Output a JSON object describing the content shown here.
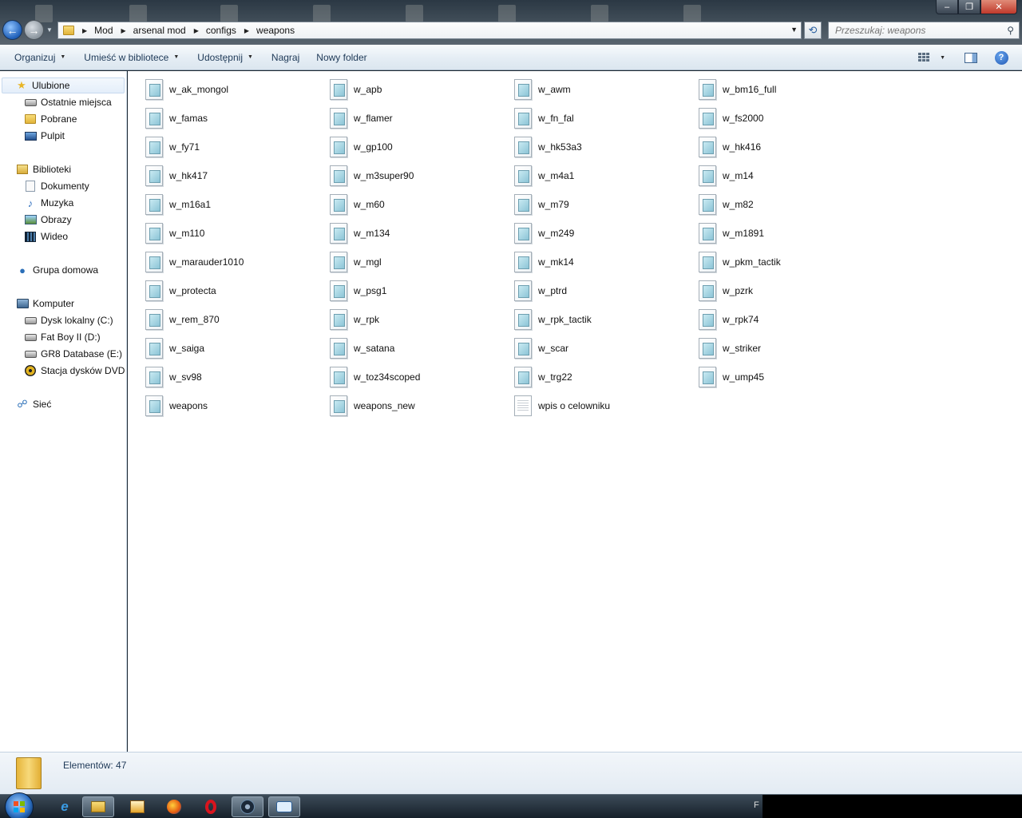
{
  "window": {
    "minimize_label": "–",
    "maximize_label": "❐",
    "close_label": "✕"
  },
  "address": {
    "crumbs": [
      "Mod",
      "arsenal mod",
      "configs",
      "weapons"
    ]
  },
  "search": {
    "placeholder": "Przeszukaj: weapons"
  },
  "toolbar": {
    "organize": "Organizuj",
    "include_library": "Umieść w bibliotece",
    "share": "Udostępnij",
    "burn": "Nagraj",
    "new_folder": "Nowy folder"
  },
  "nav": {
    "favorites": "Ulubione",
    "recent": "Ostatnie miejsca",
    "downloads": "Pobrane",
    "desktop": "Pulpit",
    "libraries": "Biblioteki",
    "documents": "Dokumenty",
    "music": "Muzyka",
    "pictures": "Obrazy",
    "videos": "Wideo",
    "homegroup": "Grupa domowa",
    "computer": "Komputer",
    "drive_c": "Dysk lokalny (C:)",
    "drive_d": "Fat Boy II (D:)",
    "drive_e": "GR8 Database (E:)",
    "drive_dvd": "Stacja dysków DVD F",
    "network": "Sieć"
  },
  "files": [
    {
      "name": "w_ak_mongol",
      "type": "cfg"
    },
    {
      "name": "w_apb",
      "type": "cfg"
    },
    {
      "name": "w_awm",
      "type": "cfg"
    },
    {
      "name": "w_bm16_full",
      "type": "cfg"
    },
    {
      "name": "w_famas",
      "type": "cfg"
    },
    {
      "name": "w_flamer",
      "type": "cfg"
    },
    {
      "name": "w_fn_fal",
      "type": "cfg"
    },
    {
      "name": "w_fs2000",
      "type": "cfg"
    },
    {
      "name": "w_fy71",
      "type": "cfg"
    },
    {
      "name": "w_gp100",
      "type": "cfg"
    },
    {
      "name": "w_hk53a3",
      "type": "cfg"
    },
    {
      "name": "w_hk416",
      "type": "cfg"
    },
    {
      "name": "w_hk417",
      "type": "cfg"
    },
    {
      "name": "w_m3super90",
      "type": "cfg"
    },
    {
      "name": "w_m4a1",
      "type": "cfg"
    },
    {
      "name": "w_m14",
      "type": "cfg"
    },
    {
      "name": "w_m16a1",
      "type": "cfg"
    },
    {
      "name": "w_m60",
      "type": "cfg"
    },
    {
      "name": "w_m79",
      "type": "cfg"
    },
    {
      "name": "w_m82",
      "type": "cfg"
    },
    {
      "name": "w_m110",
      "type": "cfg"
    },
    {
      "name": "w_m134",
      "type": "cfg"
    },
    {
      "name": "w_m249",
      "type": "cfg"
    },
    {
      "name": "w_m1891",
      "type": "cfg"
    },
    {
      "name": "w_marauder1010",
      "type": "cfg"
    },
    {
      "name": "w_mgl",
      "type": "cfg"
    },
    {
      "name": "w_mk14",
      "type": "cfg"
    },
    {
      "name": "w_pkm_tactik",
      "type": "cfg"
    },
    {
      "name": "w_protecta",
      "type": "cfg"
    },
    {
      "name": "w_psg1",
      "type": "cfg"
    },
    {
      "name": "w_ptrd",
      "type": "cfg"
    },
    {
      "name": "w_pzrk",
      "type": "cfg"
    },
    {
      "name": "w_rem_870",
      "type": "cfg"
    },
    {
      "name": "w_rpk",
      "type": "cfg"
    },
    {
      "name": "w_rpk_tactik",
      "type": "cfg"
    },
    {
      "name": "w_rpk74",
      "type": "cfg"
    },
    {
      "name": "w_saiga",
      "type": "cfg"
    },
    {
      "name": "w_satana",
      "type": "cfg"
    },
    {
      "name": "w_scar",
      "type": "cfg"
    },
    {
      "name": "w_striker",
      "type": "cfg"
    },
    {
      "name": "w_sv98",
      "type": "cfg"
    },
    {
      "name": "w_toz34scoped",
      "type": "cfg"
    },
    {
      "name": "w_trg22",
      "type": "cfg"
    },
    {
      "name": "w_ump45",
      "type": "cfg"
    },
    {
      "name": "weapons",
      "type": "cfg"
    },
    {
      "name": "weapons_new",
      "type": "cfg"
    },
    {
      "name": "wpis o celowniku",
      "type": "txt"
    }
  ],
  "status": {
    "item_count": "Elementów: 47"
  },
  "tray": {
    "mark": "F"
  }
}
